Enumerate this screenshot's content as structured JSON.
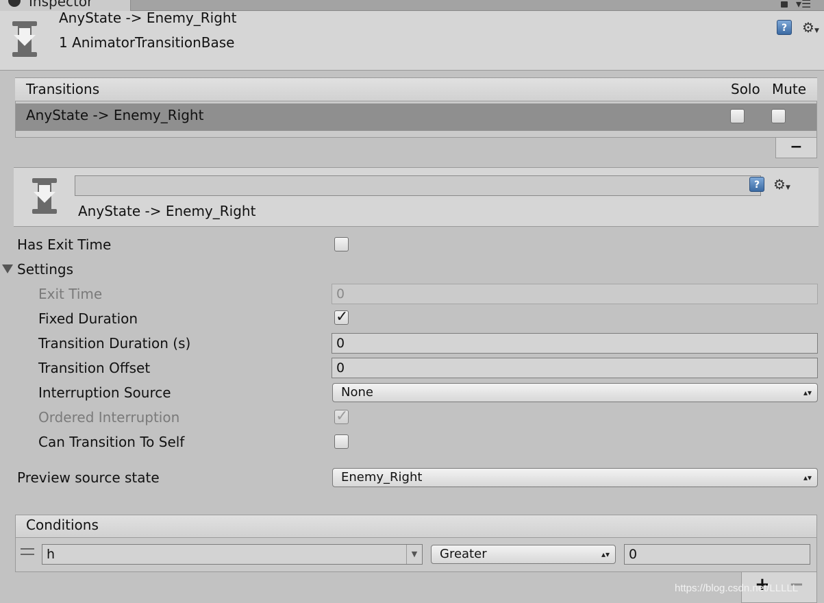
{
  "window": {
    "tab_title": "Inspector"
  },
  "header": {
    "title": "AnyState -> Enemy_Right",
    "subtitle": "1 AnimatorTransitionBase"
  },
  "transitions": {
    "header_label": "Transitions",
    "solo_label": "Solo",
    "mute_label": "Mute",
    "rows": [
      {
        "label": "AnyState -> Enemy_Right",
        "solo": false,
        "mute": false
      }
    ],
    "remove_label": "−"
  },
  "transition": {
    "name_value": "",
    "title": "AnyState -> Enemy_Right"
  },
  "properties": {
    "has_exit_time": {
      "label": "Has Exit Time",
      "checked": false
    },
    "settings_label": "Settings",
    "exit_time": {
      "label": "Exit Time",
      "value": "0"
    },
    "fixed_duration": {
      "label": "Fixed Duration",
      "checked": true
    },
    "transition_duration": {
      "label": "Transition Duration (s)",
      "value": "0"
    },
    "transition_offset": {
      "label": "Transition Offset",
      "value": "0"
    },
    "interruption_source": {
      "label": "Interruption Source",
      "value": "None"
    },
    "ordered_interruption": {
      "label": "Ordered Interruption",
      "checked": true
    },
    "can_transition_to_self": {
      "label": "Can Transition To Self",
      "checked": false
    },
    "preview_source_state": {
      "label": "Preview source state",
      "value": "Enemy_Right"
    }
  },
  "conditions": {
    "header_label": "Conditions",
    "rows": [
      {
        "parameter": "h",
        "mode": "Greater",
        "threshold": "0"
      }
    ],
    "add_label": "+",
    "remove_label": "−"
  },
  "watermark": "https://blog.csdn.net/LLLLL"
}
